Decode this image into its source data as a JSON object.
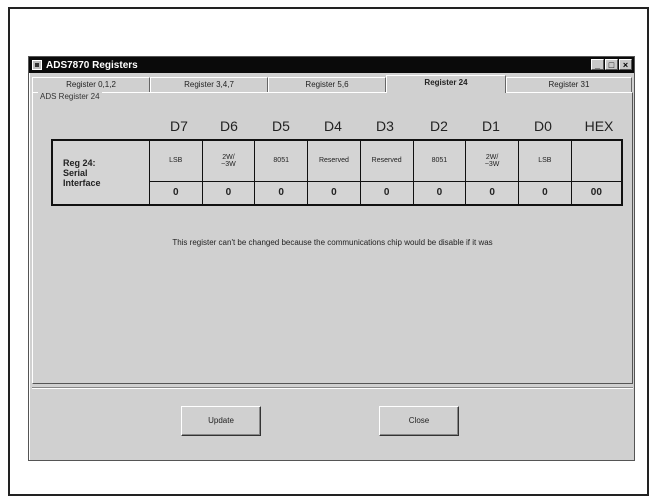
{
  "window": {
    "title": "ADS7870 Registers",
    "buttons": [
      "_",
      "□",
      "×"
    ]
  },
  "tabs": [
    {
      "label": "Register 0,1,2",
      "active": false
    },
    {
      "label": "Register 3,4,7",
      "active": false
    },
    {
      "label": "Register 5,6",
      "active": false
    },
    {
      "label": "Register 24",
      "active": true
    },
    {
      "label": "Register 31",
      "active": false
    }
  ],
  "group_label": "ADS Register 24",
  "bit_headers": [
    "D7",
    "D6",
    "D5",
    "D4",
    "D3",
    "D2",
    "D1",
    "D0",
    "HEX"
  ],
  "register": {
    "label_line1": "Reg 24:",
    "label_line2": "Serial",
    "label_line3": "Interface",
    "bit_names": [
      "LSB",
      "2W/\n~3W",
      "8051",
      "Reserved",
      "Reserved",
      "8051",
      "2W/\n~3W",
      "LSB",
      ""
    ],
    "bit_values": [
      "0",
      "0",
      "0",
      "0",
      "0",
      "0",
      "0",
      "0",
      "00"
    ]
  },
  "message": "This register can't be changed because the communications chip would be disable if it was",
  "actions": {
    "update_label": "Update",
    "close_label": "Close"
  }
}
